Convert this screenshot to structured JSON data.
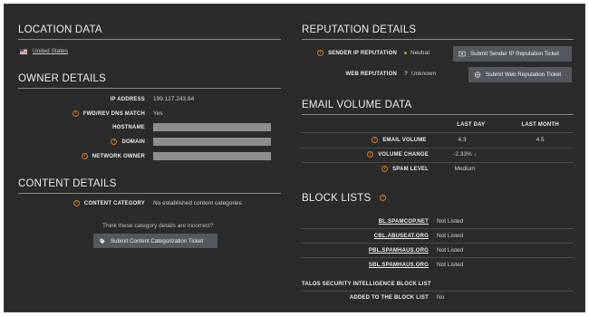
{
  "location": {
    "heading": "LOCATION DATA",
    "country": "United States",
    "flag_icon": "us-flag-icon"
  },
  "owner": {
    "heading": "OWNER DETAILS",
    "rows": [
      {
        "label": "IP ADDRESS",
        "value": "199.127.243.84",
        "help": false,
        "redacted": false
      },
      {
        "label": "FWD/REV DNS MATCH",
        "value": "Yes",
        "help": true,
        "redacted": false
      },
      {
        "label": "HOSTNAME",
        "value": "",
        "help": false,
        "redacted": true
      },
      {
        "label": "DOMAIN",
        "value": "",
        "help": true,
        "redacted": true
      },
      {
        "label": "NETWORK OWNER",
        "value": "",
        "help": true,
        "redacted": true
      }
    ]
  },
  "content": {
    "heading": "CONTENT DETAILS",
    "category_label": "CONTENT CATEGORY",
    "category_value": "No established content categories",
    "incorrect_text": "Think these category details are incorrect?",
    "submit_label": "Submit Content Categorization Ticket"
  },
  "reputation": {
    "heading": "REPUTATION DETAILS",
    "sender_label": "SENDER IP REPUTATION",
    "sender_value": "Neutral",
    "sender_button": "Submit Sender IP Reputation Ticket",
    "web_label": "WEB REPUTATION",
    "web_value": "Unknown",
    "web_button": "Submit Web Reputation Ticket"
  },
  "email_volume": {
    "heading": "EMAIL VOLUME DATA",
    "col_last_day": "LAST DAY",
    "col_last_month": "LAST MONTH",
    "rows": [
      {
        "label": "EMAIL VOLUME",
        "day": "4.3",
        "month": "4.5"
      },
      {
        "label": "VOLUME CHANGE",
        "day": "-2.33%",
        "month": ""
      },
      {
        "label": "SPAM LEVEL",
        "day": "Medium",
        "month": ""
      }
    ]
  },
  "block_lists": {
    "heading": "BLOCK LISTS",
    "rows": [
      {
        "name": "BL.SPAMCOP.NET",
        "status": "Not Listed"
      },
      {
        "name": "CBL.ABUSEAT.ORG",
        "status": "Not Listed"
      },
      {
        "name": "PBL.SPAMHAUS.ORG",
        "status": "Not Listed"
      },
      {
        "name": "SBL.SPAMHAUS.ORG",
        "status": "Not Listed"
      }
    ],
    "talos_label": "TALOS SECURITY INTELLIGENCE BLOCK LIST",
    "added_label": "ADDED TO THE BLOCK LIST",
    "added_value": "No"
  },
  "colors": {
    "background": "#2b2b2b",
    "accent": "#d07a2a",
    "button": "#53585e"
  }
}
